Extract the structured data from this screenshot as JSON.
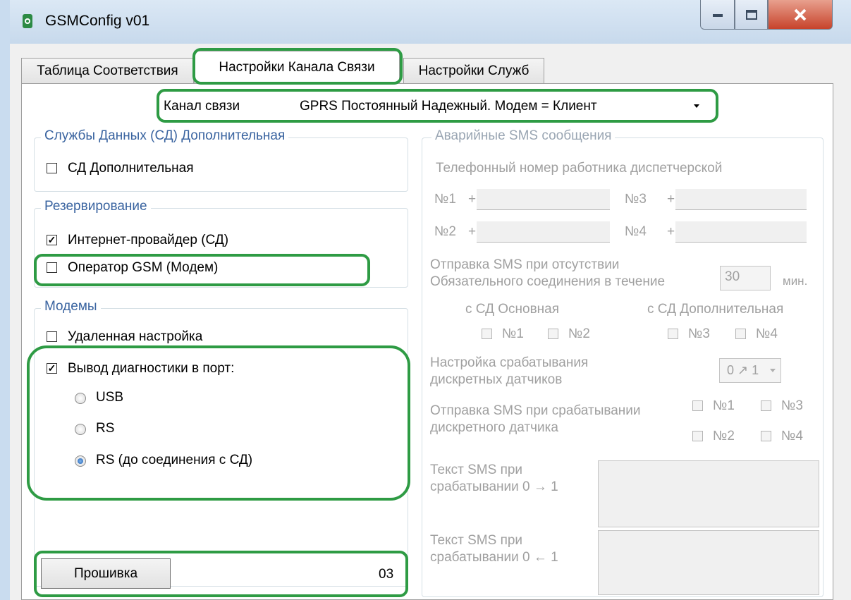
{
  "window": {
    "title": "GSMConfig v01"
  },
  "tabs": [
    {
      "label": "Таблица Соответствия"
    },
    {
      "label": "Настройки Канала Связи"
    },
    {
      "label": "Настройки Служб"
    }
  ],
  "channel": {
    "label": "Канал связи",
    "value": "GPRS Постоянный Надежный. Модем = Клиент"
  },
  "group_sd": {
    "title": "Службы Данных (СД) Дополнительная",
    "checkbox_label": "СД Дополнительная",
    "checked": false
  },
  "group_reserve": {
    "title": "Резервирование",
    "isp_label": "Интернет-провайдер (СД)",
    "isp_checked": true,
    "gsm_label": "Оператор GSM (Модем)",
    "gsm_checked": false
  },
  "group_modems": {
    "title": "Модемы",
    "remote_label": "Удаленная настройка",
    "remote_checked": false,
    "diag_label": "Вывод диагностики в порт:",
    "diag_checked": true,
    "radios": [
      {
        "label": "USB",
        "selected": false
      },
      {
        "label": "RS",
        "selected": false
      },
      {
        "label": "RS (до соединения с СД)",
        "selected": true
      }
    ]
  },
  "firmware": {
    "button_label": "Прошивка",
    "version": "03"
  },
  "sms": {
    "title": "Аварийные SMS сообщения",
    "phone_heading": "Телефонный номер работника диспетчерской",
    "phones": [
      {
        "label": "№1",
        "prefix": "+",
        "value": ""
      },
      {
        "label": "№3",
        "prefix": "+",
        "value": ""
      },
      {
        "label": "№2",
        "prefix": "+",
        "value": ""
      },
      {
        "label": "№4",
        "prefix": "+",
        "value": ""
      }
    ],
    "absence_line1": "Отправка SMS при отсутствии",
    "absence_line2": "Обязательного соединения в течение",
    "absence_value": "30",
    "absence_unit": "мин.",
    "sd_main": "с СД Основная",
    "sd_extra": "с СД Дополнительная",
    "cb_n1": "№1",
    "cb_n2": "№2",
    "cb_n3": "№3",
    "cb_n4": "№4",
    "trigger_line1": "Настройка срабатывания",
    "trigger_line2": "дискретных датчиков",
    "trigger_value": "0 ↗ 1",
    "sensor_line1": "Отправка SMS при срабатывании",
    "sensor_line2": "дискретного датчика",
    "text01_line1": "Текст SMS при",
    "text01_line2": "срабатывании 0 → 1",
    "text10_line1": "Текст SMS при",
    "text10_line2": "срабатывании 0 ← 1"
  }
}
